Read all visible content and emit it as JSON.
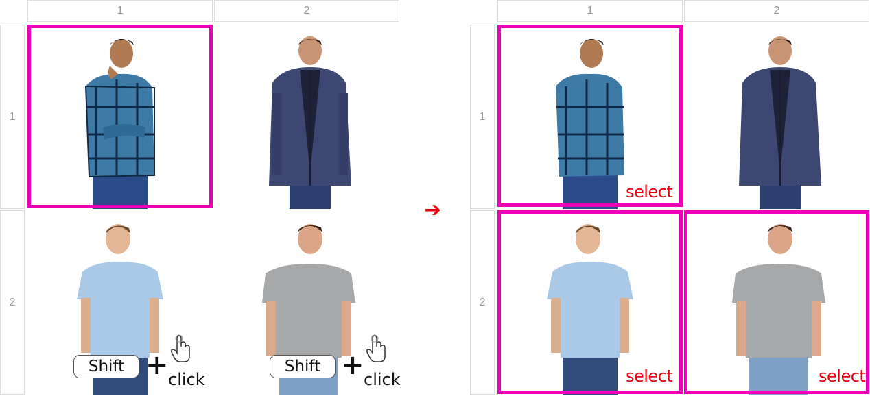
{
  "before": {
    "col_headers": [
      "1",
      "2"
    ],
    "row_headers": [
      "1",
      "2"
    ],
    "cells": [
      {
        "id": "r1c1",
        "person": "plaid-shirt-man",
        "selected": true
      },
      {
        "id": "r1c2",
        "person": "navy-jacket-man",
        "selected": false
      },
      {
        "id": "r2c1",
        "person": "light-blue-tee-man",
        "selected": false
      },
      {
        "id": "r2c2",
        "person": "gray-tee-man",
        "selected": false
      }
    ],
    "hints": [
      {
        "key": "Shift",
        "plus": "+",
        "action": "click"
      },
      {
        "key": "Shift",
        "plus": "+",
        "action": "click"
      }
    ]
  },
  "arrow": "➔",
  "after": {
    "col_headers": [
      "1",
      "2"
    ],
    "row_headers": [
      "1",
      "2"
    ],
    "select_labels": [
      "select",
      "select",
      "select"
    ]
  },
  "colors": {
    "selection_border": "#ee00b8",
    "select_text": "#e8000a",
    "arrow": "#e8000a",
    "header_text": "#9a9a9a",
    "header_border": "#dcdcdc"
  }
}
